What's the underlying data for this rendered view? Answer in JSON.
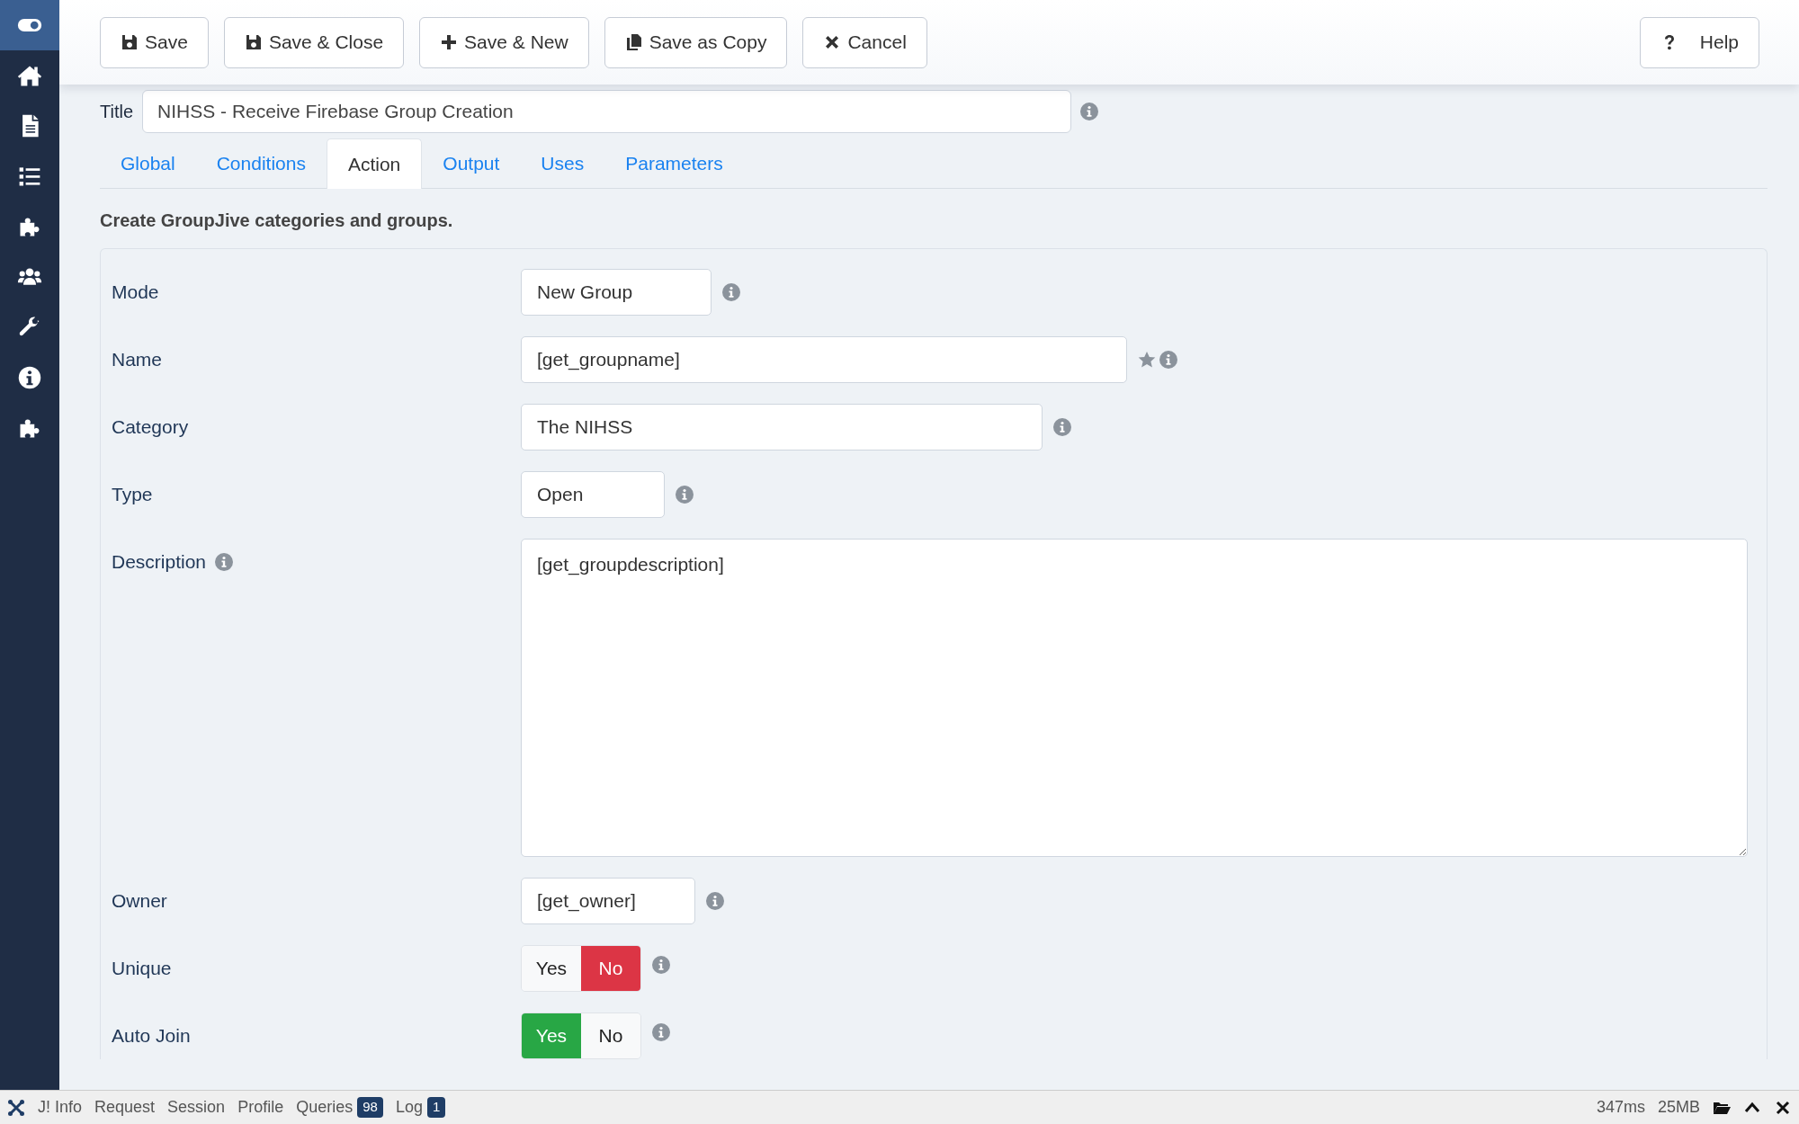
{
  "sidebar": {
    "items": [
      {
        "kind": "toggle",
        "selected": true
      },
      {
        "kind": "home",
        "selected": false
      },
      {
        "kind": "file",
        "selected": false
      },
      {
        "kind": "list",
        "selected": false
      },
      {
        "kind": "puzzle",
        "selected": false
      },
      {
        "kind": "users",
        "selected": false
      },
      {
        "kind": "wrench",
        "selected": false
      },
      {
        "kind": "info",
        "selected": false
      },
      {
        "kind": "puzzle",
        "selected": false
      }
    ]
  },
  "toolbar": {
    "buttons": [
      {
        "kind": "save",
        "label": "Save"
      },
      {
        "kind": "save",
        "label": "Save & Close"
      },
      {
        "kind": "plus",
        "label": "Save & New"
      },
      {
        "kind": "copy",
        "label": "Save as Copy"
      },
      {
        "kind": "cancel",
        "label": "Cancel"
      }
    ],
    "help": {
      "label": "Help"
    }
  },
  "title_field": {
    "label": "Title",
    "value": "NIHSS - Receive Firebase Group Creation"
  },
  "tabs": [
    {
      "label": "Global",
      "selected": false
    },
    {
      "label": "Conditions",
      "selected": false
    },
    {
      "label": "Action",
      "selected": true
    },
    {
      "label": "Output",
      "selected": false
    },
    {
      "label": "Uses",
      "selected": false
    },
    {
      "label": "Parameters",
      "selected": false
    }
  ],
  "section_heading": "Create GroupJive categories and groups.",
  "fields": [
    {
      "kind": "select",
      "label": "Mode",
      "value": "New Group"
    },
    {
      "kind": "text",
      "label": "Name",
      "value": "[get_groupname]",
      "required": true
    },
    {
      "kind": "select",
      "label": "Category",
      "value": "The NIHSS"
    },
    {
      "kind": "select",
      "label": "Type",
      "value": "Open"
    },
    {
      "kind": "textarea",
      "label": "Description",
      "value": "[get_groupdescription]"
    },
    {
      "kind": "text",
      "label": "Owner",
      "value": "[get_owner]"
    },
    {
      "kind": "toggle",
      "label": "Unique",
      "options": [
        {
          "label": "Yes",
          "selected": false
        },
        {
          "label": "No",
          "selected": true
        }
      ]
    },
    {
      "kind": "toggle",
      "label": "Auto Join",
      "options": [
        {
          "label": "Yes",
          "selected": true
        },
        {
          "label": "No",
          "selected": false
        }
      ]
    }
  ],
  "debug_bar": {
    "items": [
      {
        "label": "J! Info"
      },
      {
        "label": "Request"
      },
      {
        "label": "Session"
      },
      {
        "label": "Profile"
      },
      {
        "label": "Queries",
        "count": "98"
      },
      {
        "label": "Log",
        "count": "1"
      }
    ],
    "time": "347ms",
    "memory": "25MB"
  }
}
